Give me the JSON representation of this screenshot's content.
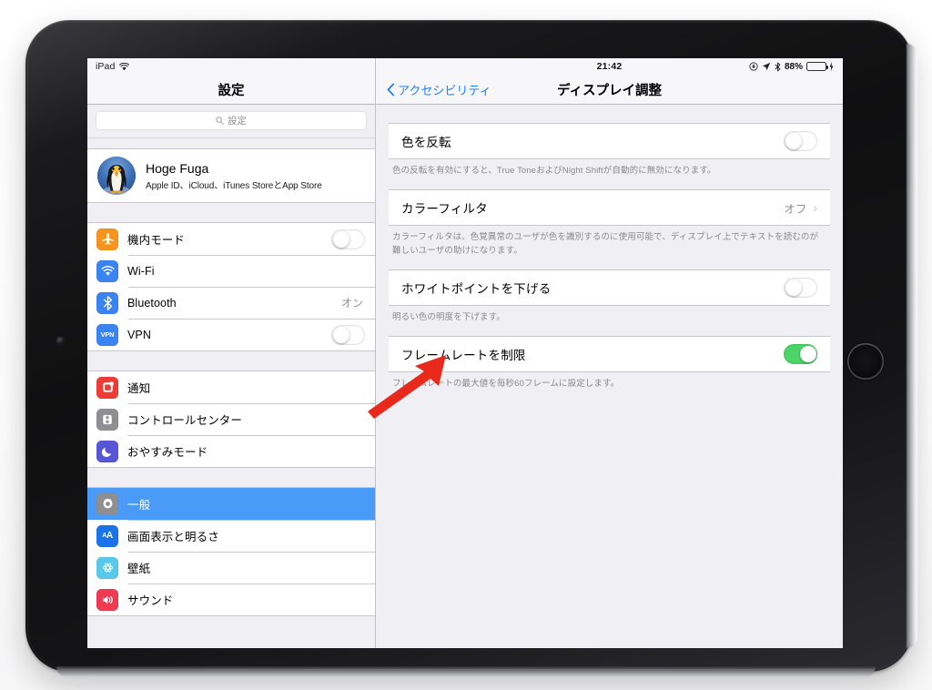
{
  "device": {
    "name": "iPad"
  },
  "sidebar": {
    "status": {
      "carrier_label": "iPad",
      "wifi_icon": "wifi-icon"
    },
    "title": "設定",
    "search": {
      "placeholder": "設定",
      "value": "",
      "icon": "search-icon"
    },
    "account": {
      "name": "Hoge Fuga",
      "subtitle": "Apple ID、iCloud、iTunes StoreとApp Store",
      "avatar_icon": "penguin-avatar"
    },
    "groups": [
      {
        "items": [
          {
            "label": "機内モード",
            "icon": "airplane-icon",
            "icon_color": "#f7941e",
            "control": "toggle",
            "toggle_on": false
          },
          {
            "label": "Wi-Fi",
            "icon": "wifi-icon",
            "icon_color": "#3a84f2",
            "control": "none"
          },
          {
            "label": "Bluetooth",
            "icon": "bluetooth-icon",
            "icon_color": "#3a84f2",
            "control": "value",
            "value": "オン"
          },
          {
            "label": "VPN",
            "icon": "vpn-icon",
            "icon_color": "#3a84f2",
            "control": "toggle",
            "toggle_on": false
          }
        ]
      },
      {
        "items": [
          {
            "label": "通知",
            "icon": "notifications-icon",
            "icon_color": "#ee3b34",
            "control": "none"
          },
          {
            "label": "コントロールセンター",
            "icon": "control-center-icon",
            "icon_color": "#8e8e93",
            "control": "none"
          },
          {
            "label": "おやすみモード",
            "icon": "moon-icon",
            "icon_color": "#5756d6",
            "control": "none"
          }
        ]
      },
      {
        "items": [
          {
            "label": "一般",
            "icon": "gear-icon",
            "icon_color": "#8e8e93",
            "control": "none",
            "selected": true
          },
          {
            "label": "画面表示と明るさ",
            "icon": "display-brightness-icon",
            "icon_color": "#1a74e8",
            "control": "none"
          },
          {
            "label": "壁紙",
            "icon": "wallpaper-icon",
            "icon_color": "#5ac8e8",
            "control": "none"
          },
          {
            "label": "サウンド",
            "icon": "sound-icon",
            "icon_color": "#ef3b52",
            "control": "none"
          }
        ]
      }
    ]
  },
  "detail": {
    "status": {
      "time": "21:42",
      "rotation_lock_icon": "rotation-lock-icon",
      "location_icon": "location-arrow-icon",
      "bluetooth_icon": "bluetooth-icon",
      "battery_percent": "88%",
      "battery_icon": "battery-charging-icon"
    },
    "nav": {
      "back_label": "アクセシビリティ",
      "back_icon": "chevron-left-icon",
      "title": "ディスプレイ調整"
    },
    "sections": [
      {
        "row": {
          "label": "色を反転",
          "control": "toggle",
          "toggle_on": false
        },
        "footnote": "色の反転を有効にすると、True ToneおよびNight Shiftが自動的に無効になります。"
      },
      {
        "row": {
          "label": "カラーフィルタ",
          "control": "value",
          "value": "オフ",
          "chevron": "›"
        },
        "footnote": "カラーフィルタは、色覚異常のユーザが色を識別するのに使用可能で、ディスプレイ上でテキストを読むのが難しいユーザの助けになります。"
      },
      {
        "row": {
          "label": "ホワイトポイントを下げる",
          "control": "toggle",
          "toggle_on": false
        },
        "footnote": "明るい色の明度を下げます。"
      },
      {
        "row": {
          "label": "フレームレートを制限",
          "control": "toggle",
          "toggle_on": true
        },
        "footnote": "フレームレートの最大値を毎秒60フレームに設定します。"
      }
    ]
  },
  "annotation": {
    "arrow_icon": "red-arrow-pointer",
    "color": "#e8291c"
  },
  "colors": {
    "ios_blue": "#1a82f7",
    "selection_blue": "#4a9bf7",
    "toggle_green": "#4cd469",
    "group_bg": "#efeff4",
    "separator": "#c8c7cc"
  }
}
